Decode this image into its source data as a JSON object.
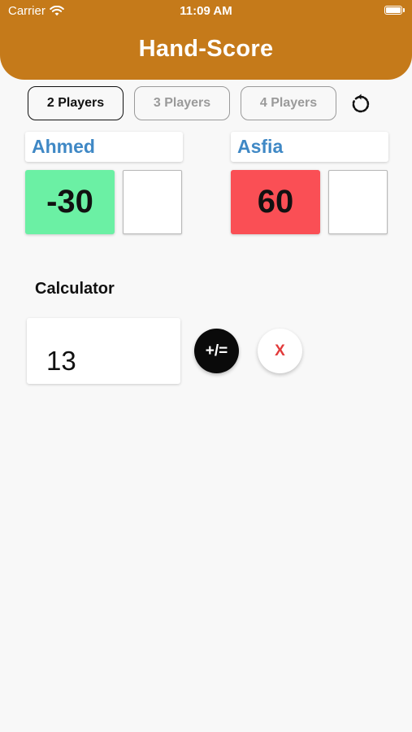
{
  "status_bar": {
    "carrier": "Carrier",
    "time": "11:09 AM",
    "wifi_icon": "wifi-icon",
    "battery_icon": "battery-icon"
  },
  "header": {
    "title": "Hand-Score",
    "color": "#c57a1a"
  },
  "modes": [
    {
      "label": "2 Players",
      "active": true
    },
    {
      "label": "3 Players",
      "active": false
    },
    {
      "label": "4 Players",
      "active": false
    }
  ],
  "reset_icon": "reset-icon",
  "players": [
    {
      "name": "Ahmed",
      "score": "-30",
      "score_color": "#6bf0a4",
      "entry": ""
    },
    {
      "name": "Asfia",
      "score": "60",
      "score_color": "#fa4f55",
      "entry": ""
    }
  ],
  "calculator": {
    "label": "Calculator",
    "value": "13",
    "apply_label": "+/=",
    "clear_label": "X"
  },
  "colors": {
    "name_text": "#3f88c5",
    "clear_text": "#e23b3b"
  }
}
